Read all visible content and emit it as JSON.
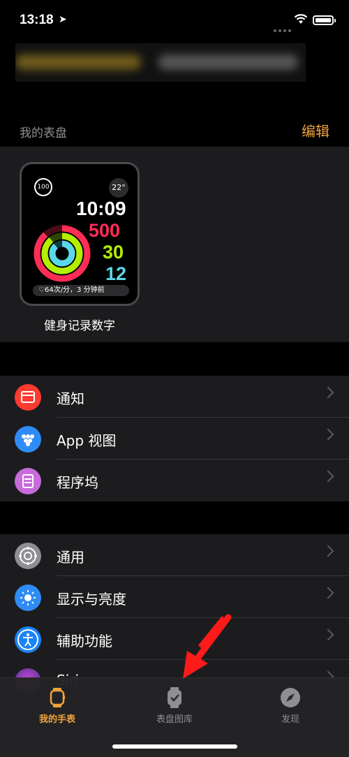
{
  "status_bar": {
    "time": "13:18"
  },
  "header": {
    "title_blurred": ""
  },
  "my_faces": {
    "section_title": "我的表盘",
    "edit_label": "编辑",
    "face": {
      "name": "健身记录数字",
      "complication_top_left": "100",
      "temperature": "22°",
      "time": "10:09",
      "move": "500",
      "exercise": "30",
      "stand": "12",
      "heart_rate": "♡64次/分，3 分钟前",
      "colors": {
        "move": "#ff2d55",
        "exercise": "#b3f000",
        "stand": "#5ad8ea"
      }
    }
  },
  "settings_group1": [
    {
      "label": "通知",
      "icon": "notifications-icon",
      "color": "#ff3b30"
    },
    {
      "label": "App 视图",
      "icon": "app-view-icon",
      "color": "#2f8cf6"
    },
    {
      "label": "程序坞",
      "icon": "dock-icon",
      "color": "#c86bdc"
    }
  ],
  "settings_group2": [
    {
      "label": "通用",
      "icon": "gear-icon",
      "color": "#8e8e93"
    },
    {
      "label": "显示与亮度",
      "icon": "brightness-icon",
      "color": "#2f8cf6"
    },
    {
      "label": "辅助功能",
      "icon": "accessibility-icon",
      "color": "#1a84f7"
    },
    {
      "label": "Siri",
      "icon": "siri-icon",
      "color": "#6d3fa8"
    }
  ],
  "tab_bar": {
    "tabs": [
      {
        "label": "我的手表",
        "icon": "my-watch-icon",
        "active": true
      },
      {
        "label": "表盘图库",
        "icon": "face-gallery-icon",
        "active": false
      },
      {
        "label": "发现",
        "icon": "discover-icon",
        "active": false
      }
    ],
    "active_color": "#f1a33b",
    "inactive_color": "#8e8e93"
  }
}
